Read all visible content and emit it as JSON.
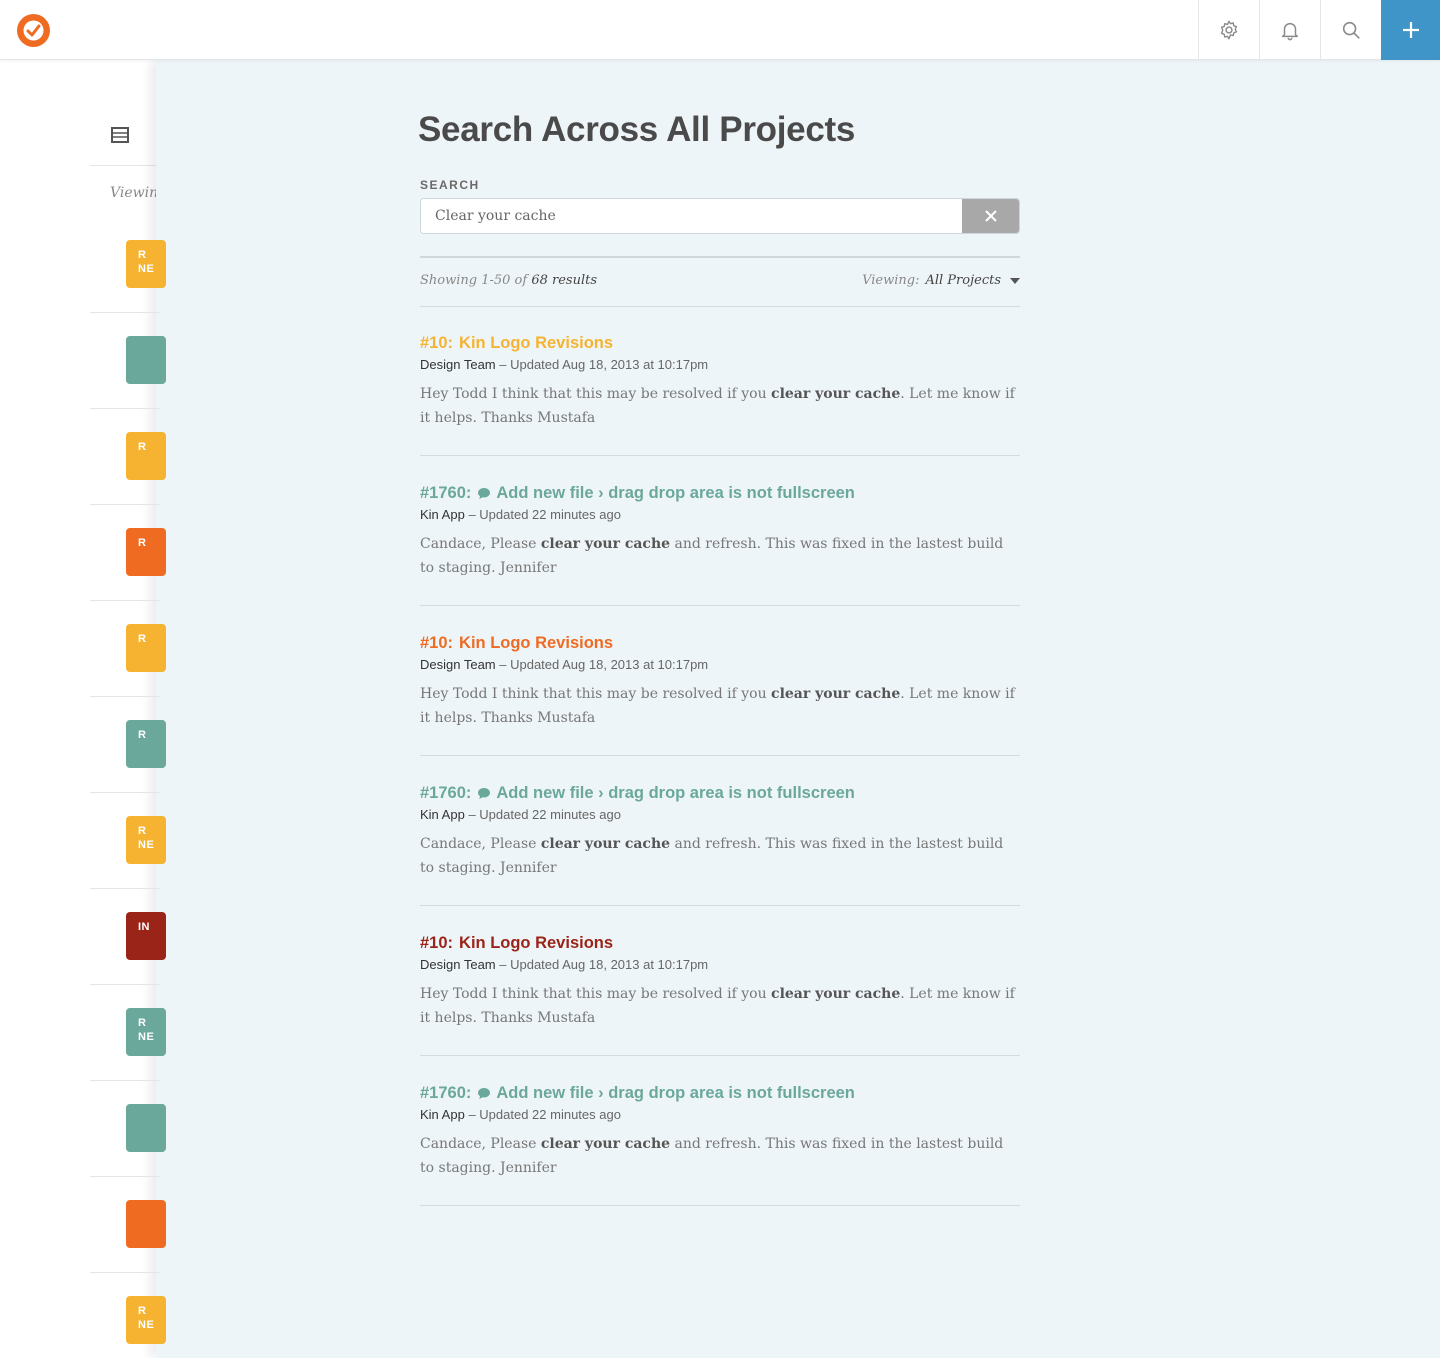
{
  "colors": {
    "brand": "#ef6b22",
    "accent_blue": "#3f95c7",
    "yellow": "#f5b331",
    "teal": "#6aa89c",
    "orange": "#ef6b22",
    "red": "#9a2418"
  },
  "topbar": {
    "logo_icon": "check-badge-icon",
    "icons": [
      "gear-icon",
      "bell-icon",
      "search-icon",
      "plus-icon"
    ]
  },
  "background": {
    "viewing_label": "Viewing",
    "tags": [
      {
        "text": "R\nNE",
        "color": "#f5b331"
      },
      {
        "text": "",
        "color": "#6aa89c"
      },
      {
        "text": "R",
        "color": "#f5b331"
      },
      {
        "text": "R",
        "color": "#ef6b22"
      },
      {
        "text": "R",
        "color": "#f5b331"
      },
      {
        "text": "R",
        "color": "#6aa89c"
      },
      {
        "text": "R\nNE",
        "color": "#f5b331"
      },
      {
        "text": "IN",
        "color": "#9a2418"
      },
      {
        "text": "R\nNE",
        "color": "#6aa89c"
      },
      {
        "text": "",
        "color": "#6aa89c"
      },
      {
        "text": "",
        "color": "#ef6b22"
      },
      {
        "text": "R\nNE",
        "color": "#f5b331"
      }
    ]
  },
  "search": {
    "title": "Search Across All Projects",
    "label": "SEARCH",
    "query": "Clear your cache",
    "showing_prefix": "Showing 1-50 of",
    "showing_count": "68 results",
    "viewing_label": "Viewing:",
    "viewing_value": "All Projects"
  },
  "results": [
    {
      "num": "#10:",
      "title": "Kin Logo Revisions",
      "color": "#f5b331",
      "comment": false,
      "team": "Design Team",
      "updated": " – Updated Aug 18, 2013 at 10:17pm",
      "body_before": "Hey Todd I think that this may be resolved if you ",
      "body_bold": "clear your cache",
      "body_after": ". Let me know if it helps. Thanks Mustafa"
    },
    {
      "num": "#1760:",
      "title": "Add new file › drag drop area is not fullscreen",
      "color": "#6aa89c",
      "comment": true,
      "team": "Kin App",
      "updated": " – Updated 22 minutes ago",
      "body_before": "Candace,  Please ",
      "body_bold": "clear your cache",
      "body_after": " and refresh. This was fixed in the lastest build to staging. Jennifer"
    },
    {
      "num": "#10:",
      "title": "Kin Logo Revisions",
      "color": "#ef6b22",
      "comment": false,
      "team": "Design Team",
      "updated": " – Updated Aug 18, 2013 at 10:17pm",
      "body_before": "Hey Todd I think that this may be resolved if you ",
      "body_bold": "clear your cache",
      "body_after": ". Let me know if it helps. Thanks Mustafa"
    },
    {
      "num": "#1760:",
      "title": "Add new file › drag drop area is not fullscreen",
      "color": "#6aa89c",
      "comment": true,
      "team": "Kin App",
      "updated": " – Updated 22 minutes ago",
      "body_before": "Candace,  Please ",
      "body_bold": "clear your cache",
      "body_after": " and refresh. This was fixed in the lastest build to staging. Jennifer"
    },
    {
      "num": "#10:",
      "title": "Kin Logo Revisions",
      "color": "#9a2418",
      "comment": false,
      "team": "Design Team",
      "updated": " – Updated Aug 18, 2013 at 10:17pm",
      "body_before": "Hey Todd I think that this may be resolved if you ",
      "body_bold": "clear your cache",
      "body_after": ". Let me know if it helps. Thanks Mustafa"
    },
    {
      "num": "#1760:",
      "title": "Add new file › drag drop area is not fullscreen",
      "color": "#6aa89c",
      "comment": true,
      "team": "Kin App",
      "updated": " – Updated 22 minutes ago",
      "body_before": "Candace,  Please ",
      "body_bold": "clear your cache",
      "body_after": " and refresh. This was fixed in the lastest build to staging. Jennifer"
    }
  ]
}
